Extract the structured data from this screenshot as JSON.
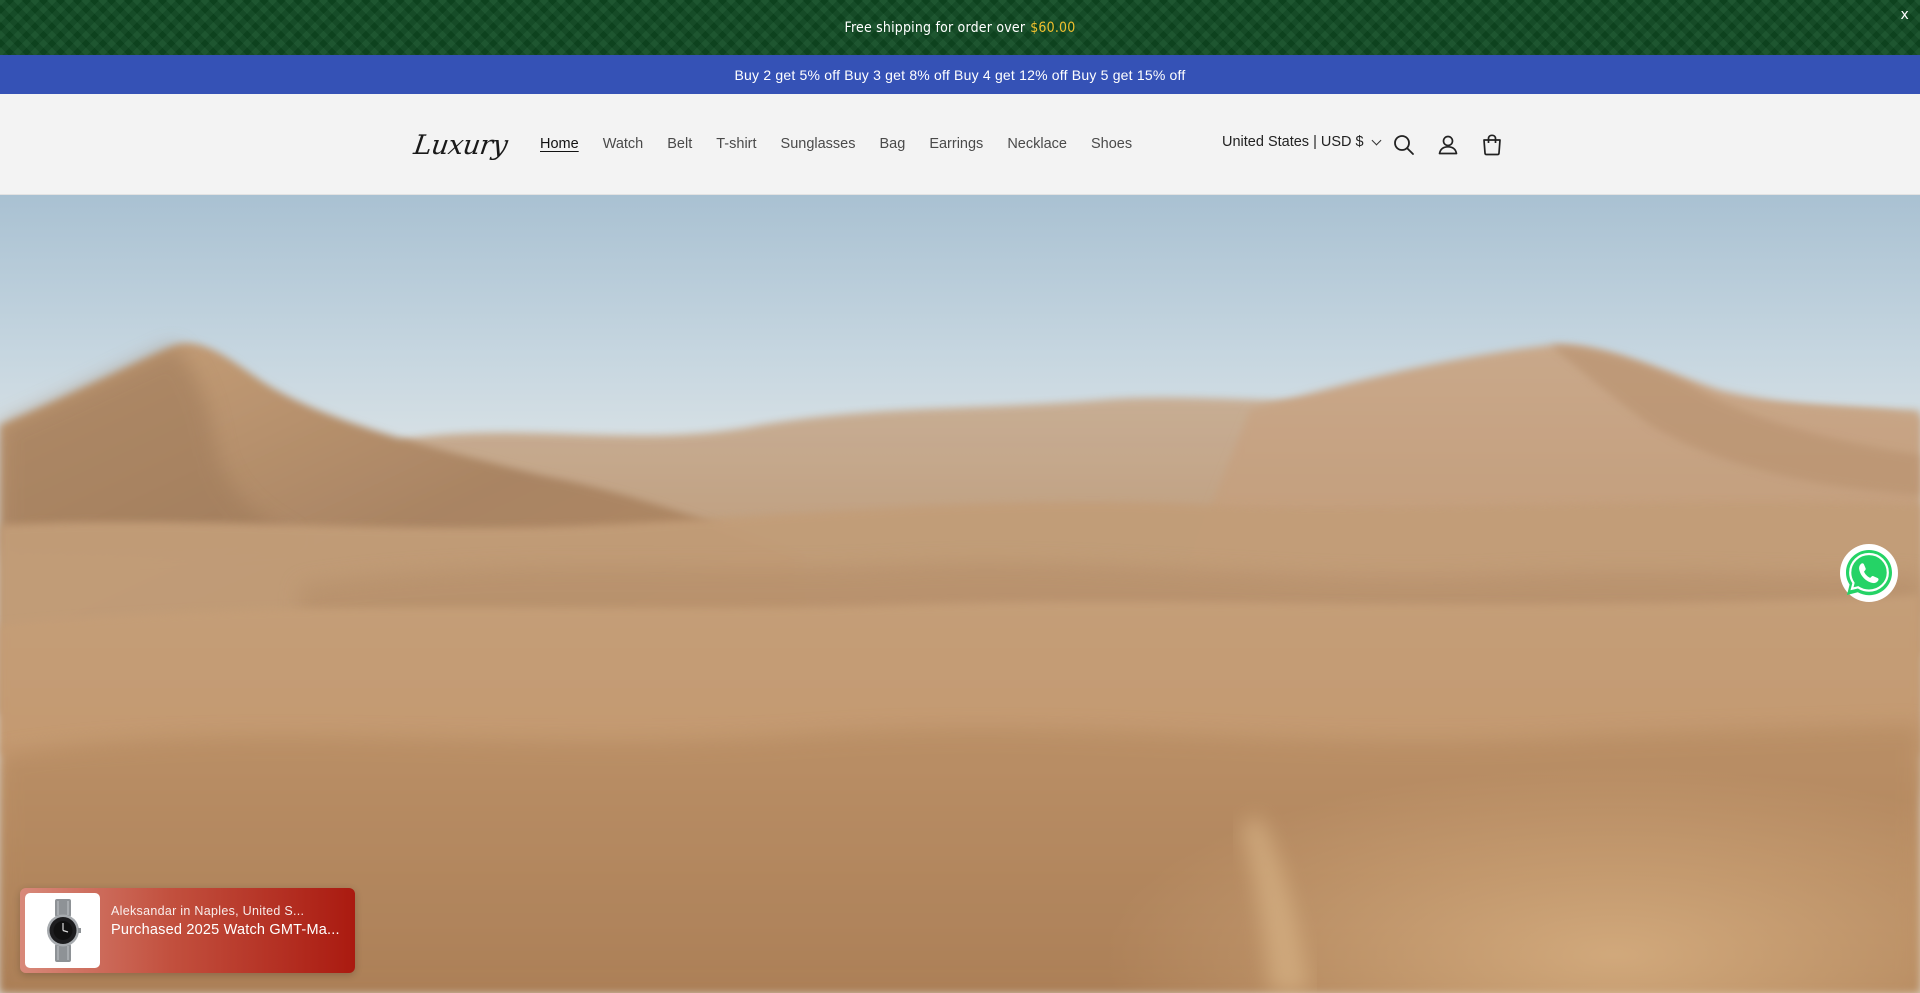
{
  "announcement": {
    "text": "Free shipping for order over",
    "amount": "$60.00",
    "close_label": "x"
  },
  "promo": {
    "text": "Buy 2 get 5% off Buy 3 get 8% off Buy 4 get 12% off Buy 5 get 15% off"
  },
  "header": {
    "logo": "Luxury",
    "nav": [
      {
        "label": "Home",
        "active": true
      },
      {
        "label": "Watch"
      },
      {
        "label": "Belt"
      },
      {
        "label": "T-shirt"
      },
      {
        "label": "Sunglasses"
      },
      {
        "label": "Bag"
      },
      {
        "label": "Earrings"
      },
      {
        "label": "Necklace"
      },
      {
        "label": "Shoes"
      }
    ],
    "country_selector": "United States | USD $",
    "icons": [
      "search-icon",
      "account-icon",
      "cart-icon"
    ]
  },
  "popup": {
    "line1": "Aleksandar in Naples, United S...",
    "line2": "Purchased 2025 Watch GMT-Ma..."
  },
  "colors": {
    "announcement_bg": "#0f4a22",
    "announcement_amount": "#f2c12e",
    "promo_bg": "#3552b6",
    "whatsapp": "#25d366"
  }
}
